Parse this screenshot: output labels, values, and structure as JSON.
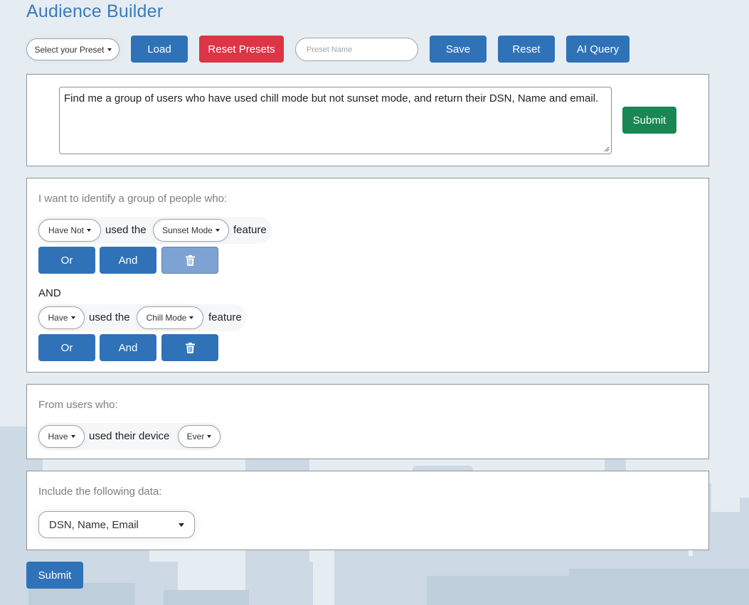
{
  "app": {
    "title": "Audience Builder"
  },
  "toolbar": {
    "preset_select": "Select your Preset",
    "load_label": "Load",
    "reset_presets_label": "Reset Presets",
    "preset_name_placeholder": "Preset Name",
    "save_label": "Save",
    "reset_label": "Reset",
    "ai_query_label": "AI Query"
  },
  "ai_query": {
    "text": "Find me a group of users who have used chill mode but not sunset mode, and return their DSN, Name and email.",
    "submit_label": "Submit"
  },
  "conditions": {
    "heading": "I want to identify a group of people who:",
    "connector": "AND",
    "used_the": "used the",
    "feature": "feature",
    "or_label": "Or",
    "and_label": "And",
    "rules": [
      {
        "have": "Have Not",
        "feature_select": "Sunset Mode",
        "delete_disabled": true
      },
      {
        "have": "Have",
        "feature_select": "Chill Mode",
        "delete_disabled": false
      }
    ]
  },
  "device_usage": {
    "heading": "From users who:",
    "have": "Have",
    "used_device": "used their device",
    "period": "Ever"
  },
  "include_data": {
    "heading": "Include the following data:",
    "selected": "DSN, Name, Email"
  },
  "footer": {
    "submit_label": "Submit"
  },
  "colors": {
    "primary": "#2f72b8",
    "danger": "#dc3545",
    "success": "#198754",
    "title": "#3a7bbf",
    "background": "#e6edf2"
  }
}
